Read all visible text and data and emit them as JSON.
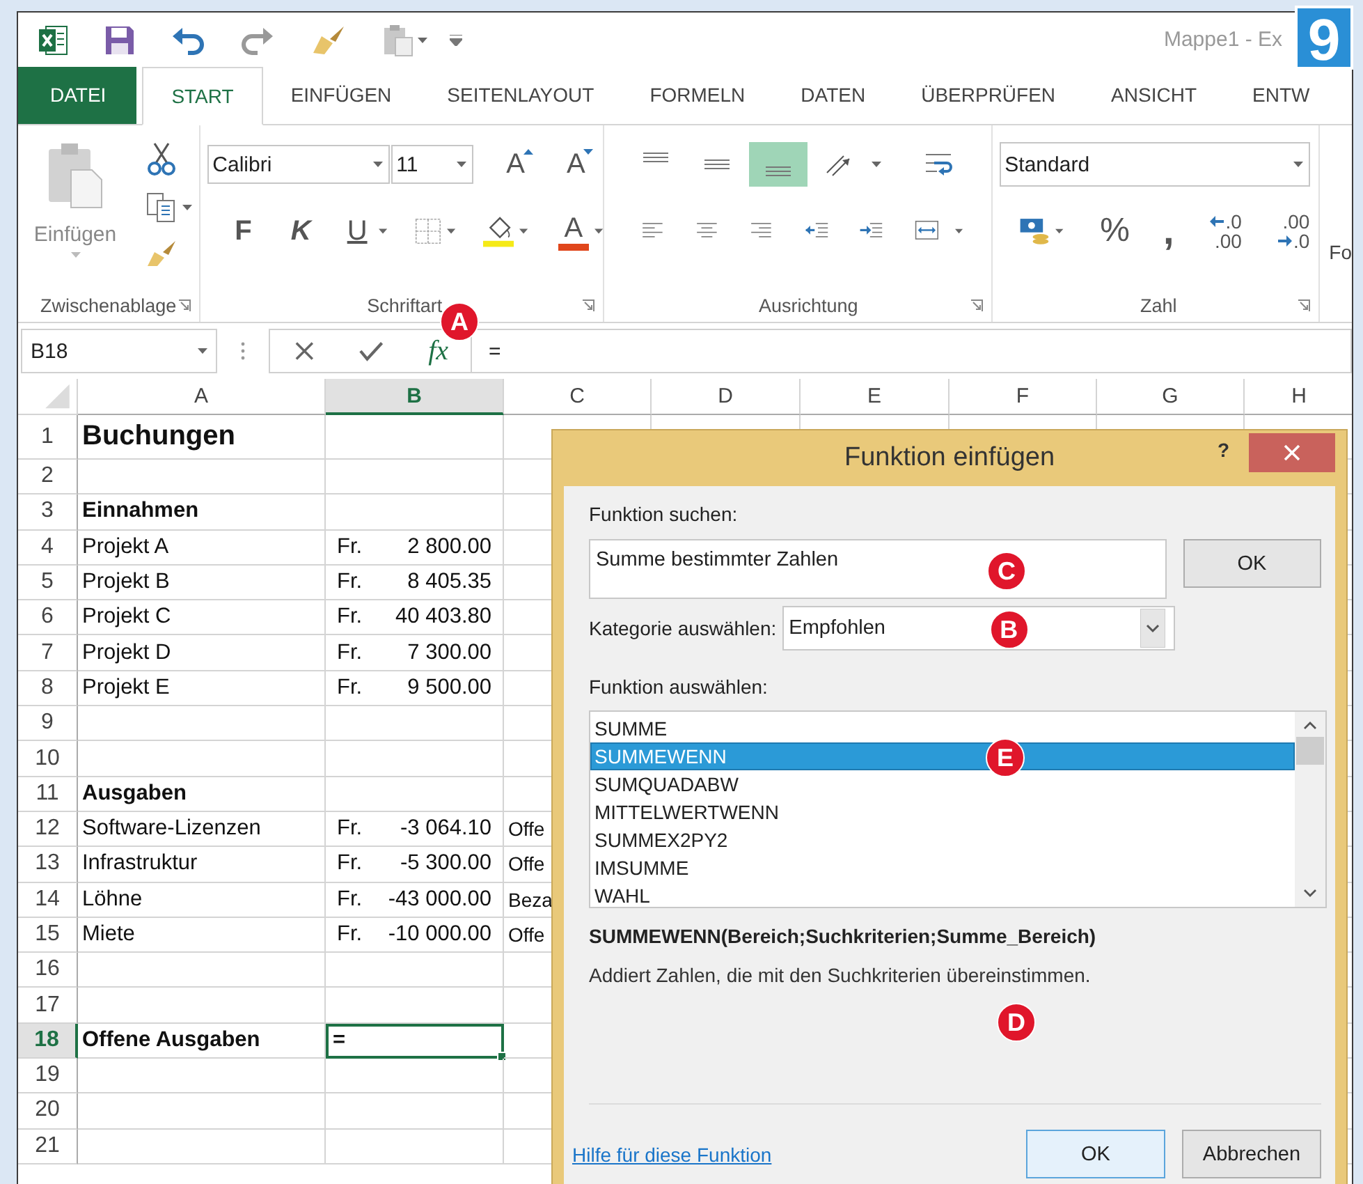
{
  "title_bar": {
    "title": "Mappe1 - Ex"
  },
  "step_badge": "9",
  "ribbon_tabs": [
    {
      "label": "DATEI",
      "kind": "file",
      "selected": false
    },
    {
      "label": "START",
      "kind": "tab",
      "selected": true
    },
    {
      "label": "EINFÜGEN",
      "kind": "tab",
      "selected": false
    },
    {
      "label": "SEITENLAYOUT",
      "kind": "tab",
      "selected": false
    },
    {
      "label": "FORMELN",
      "kind": "tab",
      "selected": false
    },
    {
      "label": "DATEN",
      "kind": "tab",
      "selected": false
    },
    {
      "label": "ÜBERPRÜFEN",
      "kind": "tab",
      "selected": false
    },
    {
      "label": "ANSICHT",
      "kind": "tab",
      "selected": false
    },
    {
      "label": "ENTW",
      "kind": "tab",
      "selected": false
    }
  ],
  "clipboard": {
    "label": "Zwischenablage",
    "paste_label": "Einfügen"
  },
  "font": {
    "label": "Schriftart",
    "font_name": "Calibri",
    "font_size": "11",
    "grow": "A",
    "shrink": "A",
    "bold": "F",
    "italic": "K",
    "underline": "U",
    "font_color": "A"
  },
  "alignment": {
    "label": "Ausrichtung",
    "tools": [
      {
        "kind": "top",
        "selected": false
      },
      {
        "kind": "middle",
        "selected": false
      },
      {
        "kind": "bottom",
        "selected": true
      },
      {
        "kind": "orientation",
        "selected": false
      },
      {
        "kind": "wrap",
        "selected": false
      },
      {
        "kind": "left",
        "selected": false
      },
      {
        "kind": "center",
        "selected": false
      },
      {
        "kind": "right",
        "selected": false
      },
      {
        "kind": "outdent",
        "selected": false
      },
      {
        "kind": "indent",
        "selected": false
      },
      {
        "kind": "merge",
        "selected": false
      }
    ]
  },
  "number": {
    "label": "Zahl",
    "format": "Standard",
    "percent": "%",
    "comma": ",",
    "increase_decimal": [
      ".0",
      ".00"
    ],
    "decrease_decimal": [
      ".00",
      ".0"
    ]
  },
  "styles_cut": "Fo",
  "formula_bar": {
    "name_box": "B18",
    "fx": "fx",
    "formula": "=",
    "callout": "A"
  },
  "sheet": {
    "columns": [
      {
        "label": "A",
        "selected": false
      },
      {
        "label": "B",
        "selected": true
      },
      {
        "label": "C",
        "selected": false
      },
      {
        "label": "D",
        "selected": false
      },
      {
        "label": "E",
        "selected": false
      },
      {
        "label": "F",
        "selected": false
      },
      {
        "label": "G",
        "selected": false
      },
      {
        "label": "H",
        "selected": false
      }
    ],
    "rows": [
      {
        "number": "1",
        "kind": "title",
        "selected": false,
        "a": "Buchungen"
      },
      {
        "number": "2",
        "kind": "normal",
        "selected": false
      },
      {
        "number": "3",
        "kind": "heading",
        "selected": false,
        "a": "Einnahmen"
      },
      {
        "number": "4",
        "kind": "normal",
        "selected": false,
        "a": "Projekt A",
        "currency": "Fr.",
        "amount": "2 800.00"
      },
      {
        "number": "5",
        "kind": "normal",
        "selected": false,
        "a": "Projekt B",
        "currency": "Fr.",
        "amount": "8 405.35"
      },
      {
        "number": "6",
        "kind": "normal",
        "selected": false,
        "a": "Projekt C",
        "currency": "Fr.",
        "amount": "40 403.80"
      },
      {
        "number": "7",
        "kind": "normal",
        "selected": false,
        "a": "Projekt D",
        "currency": "Fr.",
        "amount": "7 300.00"
      },
      {
        "number": "8",
        "kind": "normal",
        "selected": false,
        "a": "Projekt E",
        "currency": "Fr.",
        "amount": "9 500.00"
      },
      {
        "number": "9",
        "kind": "normal",
        "selected": false
      },
      {
        "number": "10",
        "kind": "normal",
        "selected": false
      },
      {
        "number": "11",
        "kind": "heading",
        "selected": false,
        "a": "Ausgaben"
      },
      {
        "number": "12",
        "kind": "normal",
        "selected": false,
        "a": "Software-Lizenzen",
        "currency": "Fr.",
        "amount": "-3 064.10",
        "c": "Offe"
      },
      {
        "number": "13",
        "kind": "normal",
        "selected": false,
        "a": "Infrastruktur",
        "currency": "Fr.",
        "amount": "-5 300.00",
        "c": "Offe"
      },
      {
        "number": "14",
        "kind": "normal",
        "selected": false,
        "a": "Löhne",
        "currency": "Fr.",
        "amount": "-43 000.00",
        "c": "Beza"
      },
      {
        "number": "15",
        "kind": "normal",
        "selected": false,
        "a": "Miete",
        "currency": "Fr.",
        "amount": "-10 000.00",
        "c": "Offe"
      },
      {
        "number": "16",
        "kind": "normal",
        "selected": false
      },
      {
        "number": "17",
        "kind": "normal",
        "selected": false
      },
      {
        "number": "18",
        "kind": "heading",
        "selected": true,
        "a": "Offene Ausgaben",
        "b": "="
      },
      {
        "number": "19",
        "kind": "normal",
        "selected": false
      },
      {
        "number": "20",
        "kind": "normal",
        "selected": false
      },
      {
        "number": "21",
        "kind": "normal",
        "selected": false
      }
    ]
  },
  "dialog": {
    "title": "Funktion einfügen",
    "help": "?",
    "search_label": "Funktion suchen:",
    "search_value": "Summe bestimmter Zahlen",
    "search_callout": "C",
    "go_button": "OK",
    "category_label": "Kategorie auswählen:",
    "category_value": "Empfohlen",
    "category_callout": "B",
    "list_label": "Funktion auswählen:",
    "functions": [
      {
        "name": "SUMME",
        "selected": false
      },
      {
        "name": "SUMMEWENN",
        "selected": true
      },
      {
        "name": "SUMQUADABW",
        "selected": false
      },
      {
        "name": "MITTELWERTWENN",
        "selected": false
      },
      {
        "name": "SUMMEX2PY2",
        "selected": false
      },
      {
        "name": "IMSUMME",
        "selected": false
      },
      {
        "name": "WAHL",
        "selected": false
      }
    ],
    "list_callout": "E",
    "syntax": "SUMMEWENN(Bereich;Suchkriterien;Summe_Bereich)",
    "description": "Addiert Zahlen, die mit den Suchkriterien übereinstimmen.",
    "description_callout": "D",
    "help_link": "Hilfe für diese Funktion",
    "ok_button": "OK",
    "cancel_button": "Abbrechen"
  }
}
